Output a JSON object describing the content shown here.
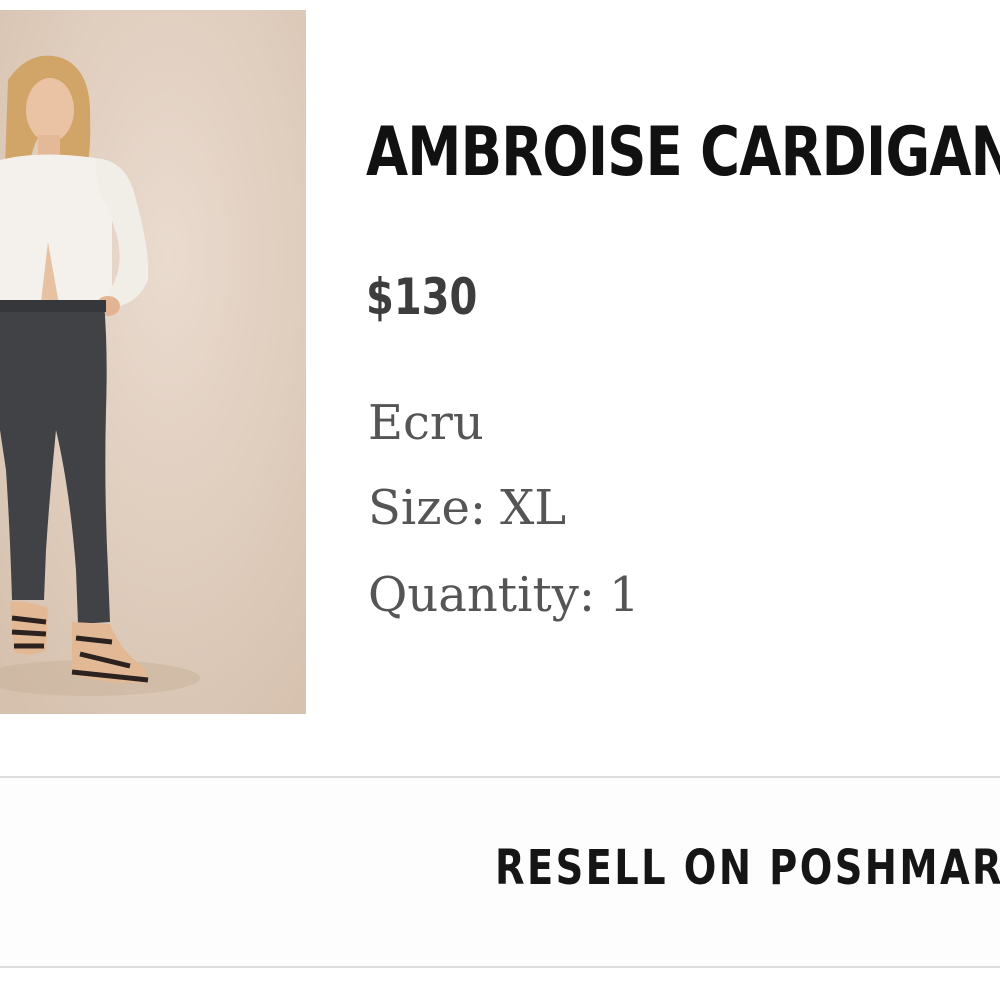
{
  "product": {
    "image_alt": "Model wearing ecru cardigan and dark jeans",
    "title": "AMBROISE CARDIGAN",
    "price": "$130",
    "color": "Ecru",
    "size_label": "Size:",
    "size_value": "XL",
    "quantity_label": "Quantity:",
    "quantity_value": "1"
  },
  "actions": {
    "resell_label": "RESELL ON POSHMARK"
  },
  "colors": {
    "title": "#111111",
    "price": "#3d3d3d",
    "detail_text": "#555555",
    "divider": "#dddddd",
    "image_background": "#dfcdbd"
  }
}
